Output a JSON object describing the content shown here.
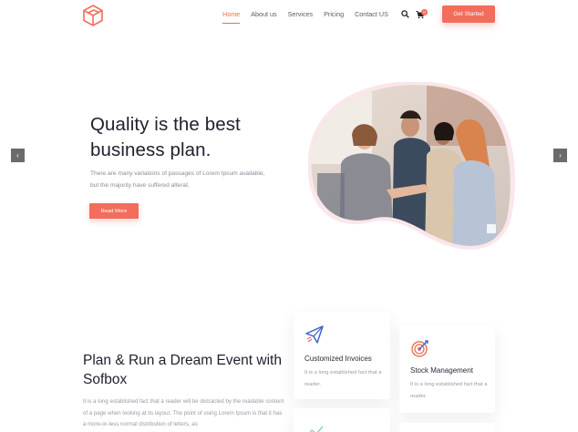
{
  "nav": {
    "links": [
      "Home",
      "About us",
      "Services",
      "Pricing",
      "Contact US"
    ],
    "cart_count": "0",
    "cta_label": "Get Started"
  },
  "hero": {
    "title_line1": "Quality is the best",
    "title_line2": "business plan.",
    "text": "There are many variations of passages of Lorem Ipsum available, but the majority have suffered alterat.",
    "button_label": "Read More",
    "prev_arrow": "‹",
    "next_arrow": "›"
  },
  "section": {
    "title": "Plan & Run a Dream Event with Sofbox",
    "text": "It is a long established fact that a reader will be distracted by the readable content of a page when looking at its layout. The point of using Lorem Ipsum is that it has a more-or-less normal distribution of letters, as"
  },
  "cards": [
    {
      "title": "Customized Invoices",
      "text": "It is a long established fact that a reader.",
      "icon": "paper-plane-icon"
    },
    {
      "title": "Stock Management",
      "text": "It is a long established fact that a reader.",
      "icon": "target-icon"
    }
  ],
  "colors": {
    "accent": "#f26d5b",
    "icon_blue": "#3a5fc8"
  }
}
